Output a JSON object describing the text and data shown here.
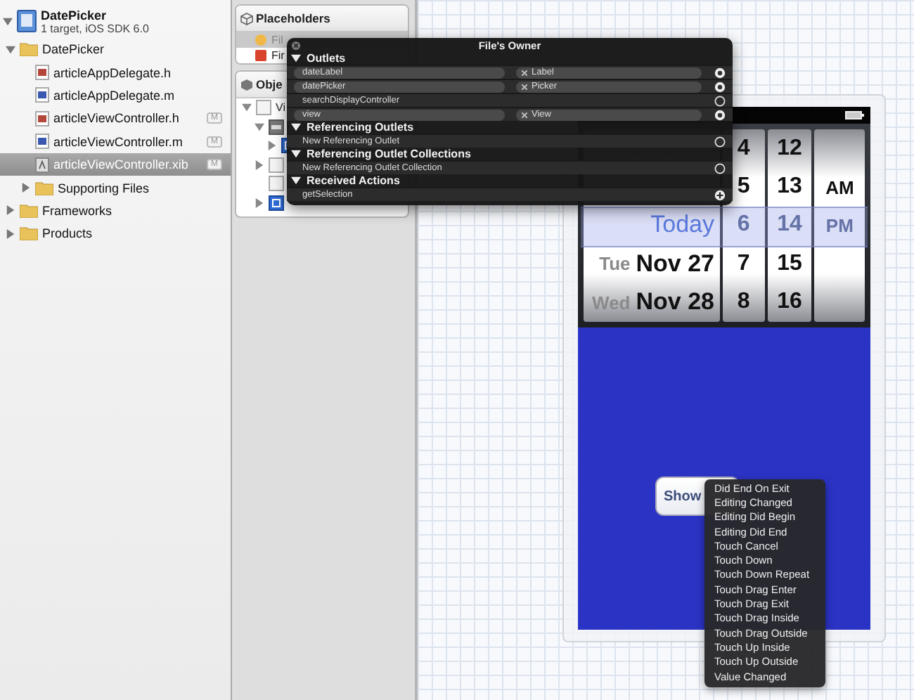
{
  "navigator": {
    "project": {
      "name": "DatePicker",
      "subtitle": "1 target, iOS SDK 6.0",
      "expanded": true
    },
    "items": [
      {
        "name": "DatePicker",
        "kind": "folder",
        "expanded": true,
        "selected": false,
        "children": [
          {
            "name": "articleAppDelegate.h",
            "kind": "header",
            "selected": false
          },
          {
            "name": "articleAppDelegate.m",
            "kind": "source",
            "selected": false
          },
          {
            "name": "articleViewController.h",
            "kind": "header",
            "selected": false,
            "badge": "M"
          },
          {
            "name": "articleViewController.m",
            "kind": "source",
            "selected": false,
            "badge": "M"
          },
          {
            "name": "articleViewController.xib",
            "kind": "xib",
            "selected": true,
            "badge": "M"
          },
          {
            "name": "Supporting Files",
            "kind": "folder",
            "expanded": false,
            "selected": false
          }
        ]
      },
      {
        "name": "Frameworks",
        "kind": "folder",
        "expanded": false,
        "selected": false
      },
      {
        "name": "Products",
        "kind": "folder",
        "expanded": false,
        "selected": false
      }
    ]
  },
  "dock": {
    "placeholders": {
      "title": "Placeholders",
      "items": [
        {
          "label": "Fil",
          "kind": "owner",
          "selected": true
        },
        {
          "label": "Fir",
          "kind": "responder",
          "selected": false
        }
      ]
    },
    "objects": {
      "title": "Obje",
      "tree": [
        {
          "label": "Vi",
          "kind": "view",
          "expanded": true,
          "children": [
            {
              "kind": "image",
              "expanded": true,
              "children": [
                {
                  "kind": "control",
                  "expanded": false
                }
              ]
            },
            {
              "kind": "view",
              "expanded": false
            },
            {
              "kind": "view"
            },
            {
              "kind": "control",
              "expanded": false
            }
          ]
        }
      ]
    }
  },
  "connections": {
    "title": "File's Owner",
    "sections": [
      {
        "title": "Outlets",
        "expanded": true,
        "rows": [
          {
            "kind": "outlet",
            "name": "dateLabel",
            "target": "Label",
            "connected": true
          },
          {
            "kind": "outlet",
            "name": "datePicker",
            "target": "Picker",
            "connected": true
          },
          {
            "kind": "outlet",
            "name": "searchDisplayController",
            "connected": false
          },
          {
            "kind": "outlet",
            "name": "view",
            "target": "View",
            "connected": true
          }
        ]
      },
      {
        "title": "Referencing Outlets",
        "expanded": true,
        "rows": [
          {
            "kind": "new",
            "name": "New Referencing Outlet",
            "connected": false
          }
        ]
      },
      {
        "title": "Referencing Outlet Collections",
        "expanded": true,
        "rows": [
          {
            "kind": "new",
            "name": "New Referencing Outlet Collection",
            "connected": false
          }
        ]
      },
      {
        "title": "Received Actions",
        "expanded": true,
        "rows": [
          {
            "kind": "action",
            "name": "getSelection"
          }
        ]
      }
    ]
  },
  "picker": {
    "dates": [
      {
        "date": "Today",
        "selected": true
      },
      {
        "weekday": "Tue",
        "date": "Nov 27",
        "selected": false
      },
      {
        "weekday": "Wed",
        "date": "Nov 28",
        "selected": false
      }
    ],
    "hours": [
      {
        "label": "4",
        "selected": false
      },
      {
        "label": "5",
        "selected": false
      },
      {
        "label": "6",
        "selected": true
      },
      {
        "label": "7",
        "selected": false
      },
      {
        "label": "8",
        "selected": false
      }
    ],
    "minutes": [
      {
        "label": "12",
        "selected": false
      },
      {
        "label": "13",
        "selected": false
      },
      {
        "label": "14",
        "selected": true
      },
      {
        "label": "15",
        "selected": false
      },
      {
        "label": "16",
        "selected": false
      }
    ],
    "ampm": [
      {
        "label": "AM",
        "selected": false
      },
      {
        "label": "PM",
        "selected": true
      }
    ]
  },
  "button": {
    "label": "Show"
  },
  "event_menu": {
    "items": [
      "Did End On Exit",
      "Editing Changed",
      "Editing Did Begin",
      "Editing Did End",
      "Touch Cancel",
      "Touch Down",
      "Touch Down Repeat",
      "Touch Drag Enter",
      "Touch Drag Exit",
      "Touch Drag Inside",
      "Touch Drag Outside",
      "Touch Up Inside",
      "Touch Up Outside",
      "Value Changed"
    ]
  }
}
